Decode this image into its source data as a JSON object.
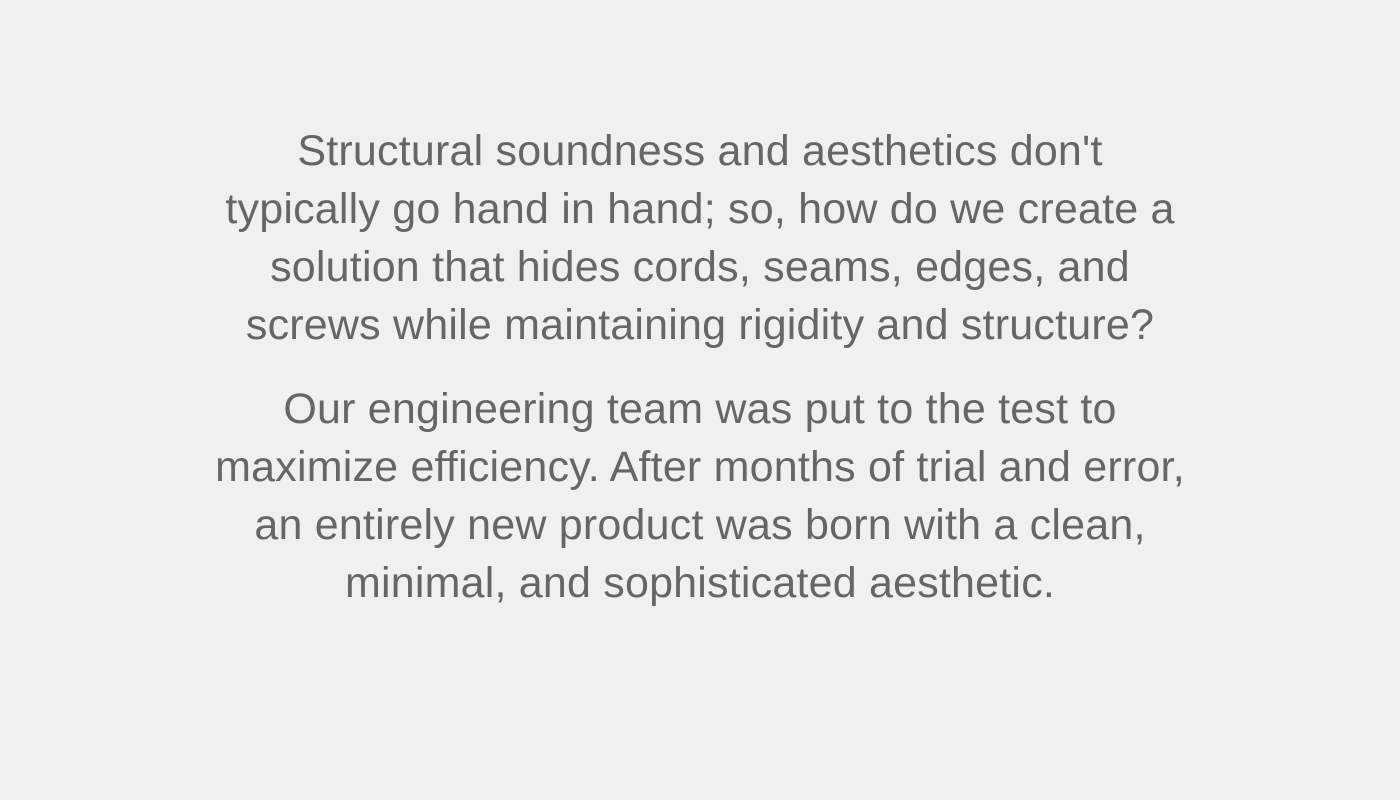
{
  "content": {
    "paragraphs": [
      "Structural soundness and aesthetics don't typically go hand in hand; so, how do we create a solution that hides cords, seams, edges, and screws while maintaining rigidity and structure?",
      "Our engineering team was put to the test to maximize efficiency. After months of trial and error, an entirely new product was born with a clean, minimal, and sophisticated aesthetic."
    ]
  },
  "colors": {
    "background": "#f0f0f0",
    "text": "#666666"
  }
}
